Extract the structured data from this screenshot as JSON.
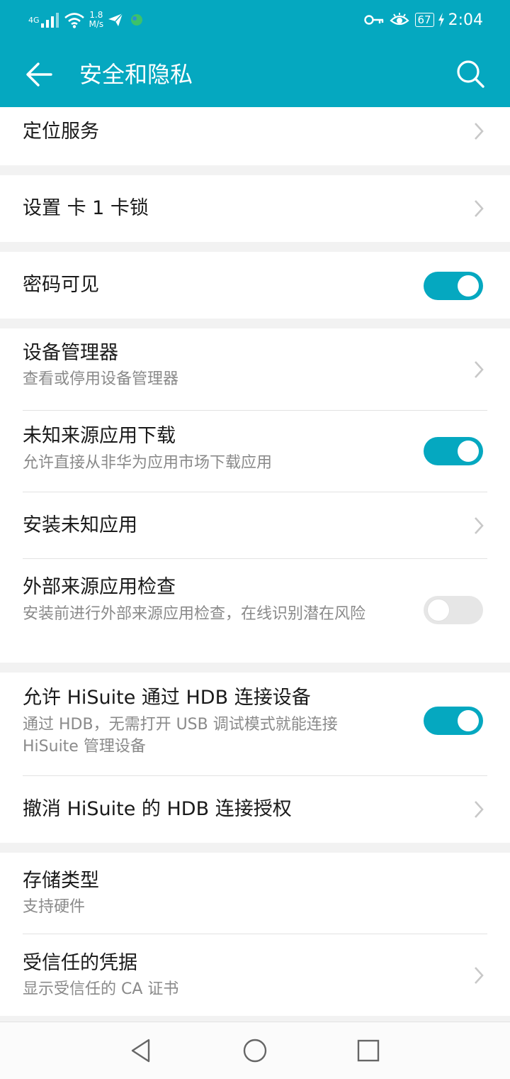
{
  "status_bar": {
    "network_type": "4G",
    "speed_value": "1.8",
    "speed_unit": "M/s",
    "battery": "67",
    "time": "2:04",
    "icons": [
      "signal-icon",
      "wifi-icon",
      "send-icon",
      "app-dot-icon",
      "key-icon",
      "eye-icon",
      "battery-icon",
      "charging-icon"
    ]
  },
  "app_bar": {
    "title": "安全和隐私",
    "icons": [
      "back-arrow-icon",
      "search-icon"
    ]
  },
  "groups": [
    {
      "items": [
        {
          "title": "定位服务",
          "control": "chevron"
        }
      ]
    },
    {
      "items": [
        {
          "title": "设置 卡 1 卡锁",
          "control": "chevron"
        }
      ]
    },
    {
      "items": [
        {
          "title": "密码可见",
          "control": "toggle",
          "on": true
        }
      ]
    },
    {
      "items": [
        {
          "title": "设备管理器",
          "subtitle": "查看或停用设备管理器",
          "control": "chevron"
        },
        {
          "title": "未知来源应用下载",
          "subtitle": "允许直接从非华为应用市场下载应用",
          "control": "toggle",
          "on": true
        },
        {
          "title": "安装未知应用",
          "control": "chevron"
        },
        {
          "title": "外部来源应用检查",
          "subtitle": "安装前进行外部来源应用检查，在线识别潜在风险",
          "control": "toggle",
          "on": false
        }
      ]
    },
    {
      "items": [
        {
          "title": "允许 HiSuite 通过 HDB 连接设备",
          "subtitle": "通过 HDB，无需打开 USB 调试模式就能连接 HiSuite 管理设备",
          "control": "toggle",
          "on": true
        },
        {
          "title": "撤消 HiSuite 的 HDB 连接授权",
          "control": "chevron"
        }
      ]
    },
    {
      "items": [
        {
          "title": "存储类型",
          "subtitle": "支持硬件",
          "control": "none"
        },
        {
          "title": "受信任的凭据",
          "subtitle": "显示受信任的 CA 证书",
          "control": "chevron"
        }
      ]
    }
  ],
  "nav_bar": {
    "icons": [
      "nav-back-icon",
      "nav-home-icon",
      "nav-recents-icon"
    ]
  },
  "colors": {
    "accent": "#05a8c0",
    "background": "#f2f2f2",
    "subtitle": "#8a8a8a",
    "toggle_off": "#e6e6e6"
  }
}
